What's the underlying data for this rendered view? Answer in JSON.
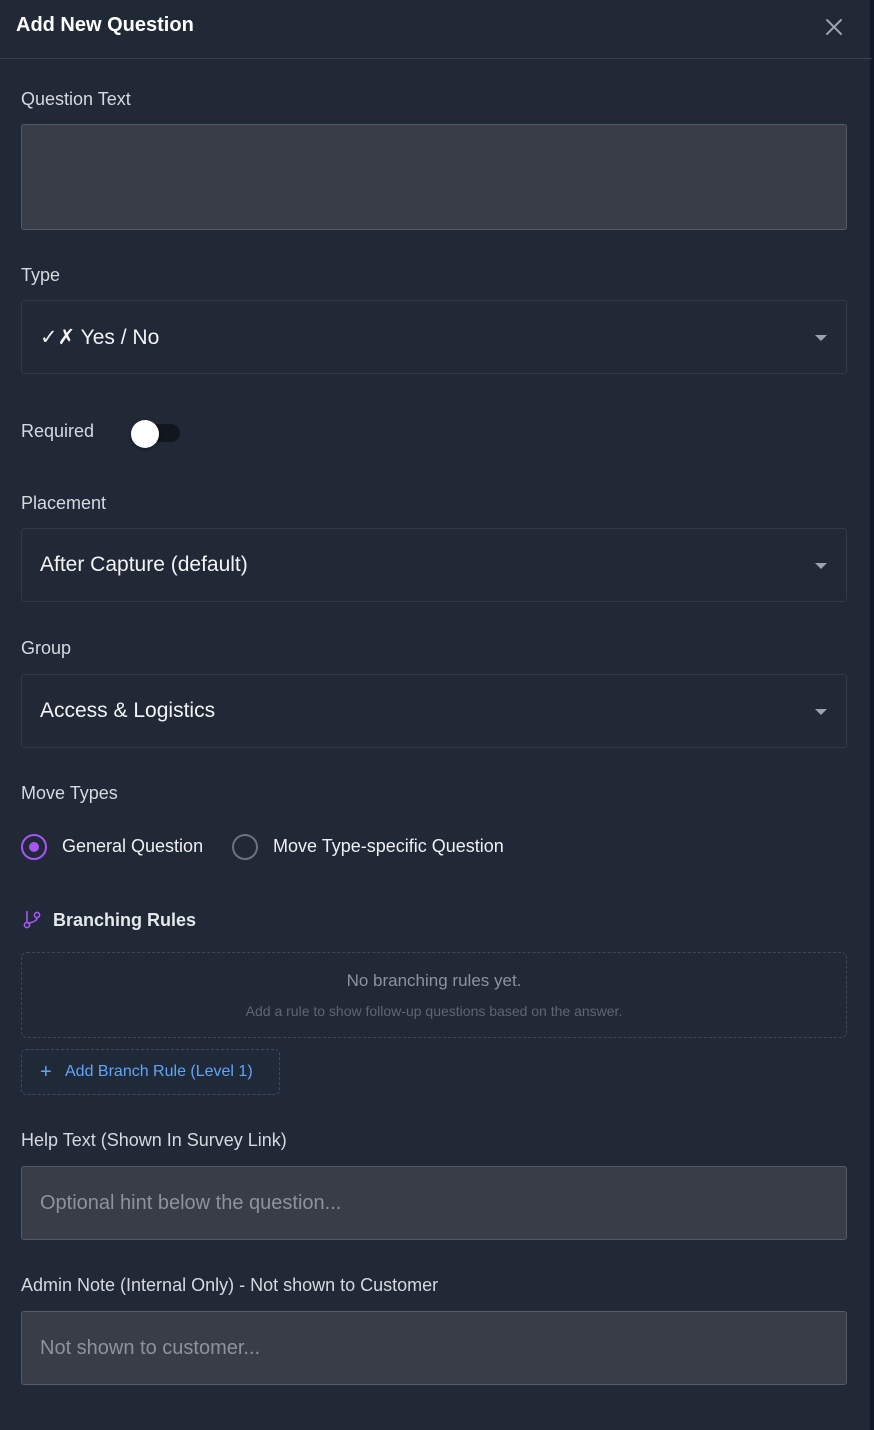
{
  "dialog": {
    "title": "Add New Question",
    "close_icon": "close-icon"
  },
  "question_text": {
    "label": "Question Text",
    "value": ""
  },
  "type": {
    "label": "Type",
    "selected": "✓✗ Yes / No"
  },
  "required": {
    "label": "Required",
    "enabled": false
  },
  "placement": {
    "label": "Placement",
    "selected": "After Capture (default)"
  },
  "group": {
    "label": "Group",
    "selected": "Access & Logistics"
  },
  "move_types": {
    "label": "Move Types",
    "options": [
      {
        "label": "General Question",
        "checked": true
      },
      {
        "label": "Move Type-specific Question",
        "checked": false
      }
    ]
  },
  "branching": {
    "icon": "git-branch-icon",
    "title": "Branching Rules",
    "empty_title": "No branching rules yet.",
    "empty_subtitle": "Add a rule to show follow-up questions based on the answer.",
    "add_button_label": "Add Branch Rule (Level 1)"
  },
  "help_text": {
    "label": "Help Text (Shown In Survey Link)",
    "placeholder": "Optional hint below the question..."
  },
  "admin_note": {
    "label": "Admin Note (Internal Only) - Not shown to Customer",
    "placeholder": "Not shown to customer..."
  },
  "colors": {
    "background": "#212836",
    "input_bg": "#383d48",
    "accent_purple": "#a855f7",
    "link_blue": "#60a5fa"
  }
}
